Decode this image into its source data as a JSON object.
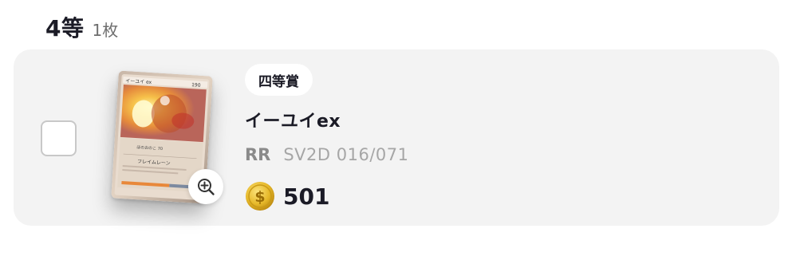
{
  "section": {
    "title": "4等",
    "count": "1枚"
  },
  "card": {
    "prize_badge": "四等賞",
    "name": "イーユイex",
    "rarity": "RR",
    "code": "SV2D 016/071",
    "price": "501",
    "thumbnail_icon": "pokemon-card-image",
    "zoom_icon": "zoom-in-icon",
    "coin_icon": "gold-coin-icon",
    "checkbox_checked": false
  },
  "colors": {
    "card_background": "#f3f3f3",
    "coin": "#e7b92a",
    "title_text": "#1b1b26",
    "muted_text": "#a6a6a6"
  }
}
